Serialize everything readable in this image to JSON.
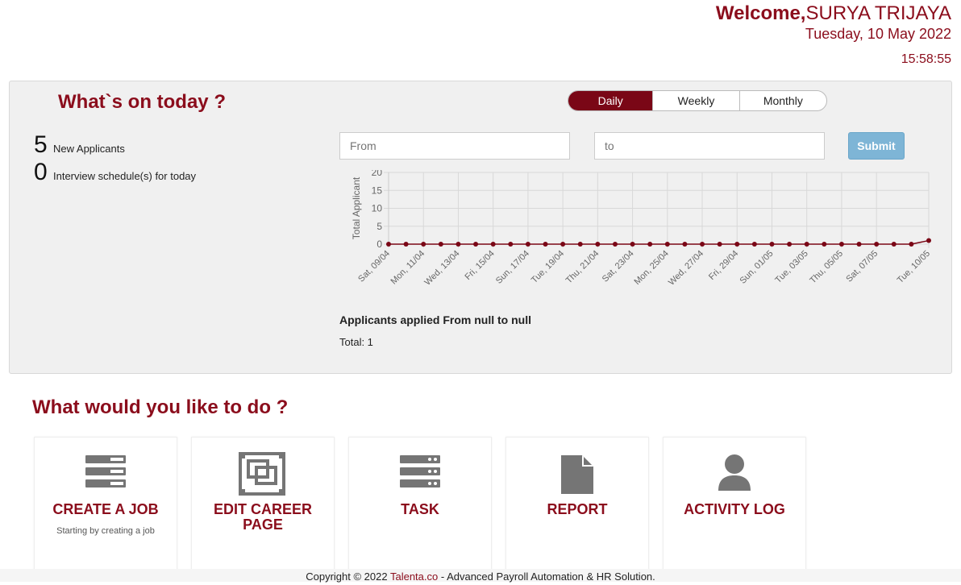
{
  "header": {
    "welcome_prefix": "Welcome,",
    "user_name": "SURYA TRIJAYA",
    "date": "Tuesday, 10 May 2022",
    "time": "15:58:55"
  },
  "today": {
    "title": "What`s on today ?",
    "tabs": [
      "Daily",
      "Weekly",
      "Monthly"
    ],
    "active_tab": "Daily",
    "stats": [
      {
        "value": "5",
        "label": "New Applicants"
      },
      {
        "value": "0",
        "label": "Interview schedule(s) for today"
      }
    ],
    "from_placeholder": "From",
    "to_placeholder": "to",
    "submit_label": "Submit",
    "applied_text": "Applicants applied From null to null",
    "total_text": "Total: 1"
  },
  "chart_data": {
    "type": "line",
    "ylabel": "Total Applicant",
    "ylim": [
      0,
      20
    ],
    "yticks": [
      0,
      5,
      10,
      15,
      20
    ],
    "x": [
      "Sat, 09/04",
      "Sun, 10/04",
      "Mon, 11/04",
      "Tue, 12/04",
      "Wed, 13/04",
      "Thu, 14/04",
      "Fri, 15/04",
      "Sat, 16/04",
      "Sun, 17/04",
      "Mon, 18/04",
      "Tue, 19/04",
      "Wed, 20/04",
      "Thu, 21/04",
      "Fri, 22/04",
      "Sat, 23/04",
      "Sun, 24/04",
      "Mon, 25/04",
      "Tue, 26/04",
      "Wed, 27/04",
      "Thu, 28/04",
      "Fri, 29/04",
      "Sat, 30/04",
      "Sun, 01/05",
      "Mon, 02/05",
      "Tue, 03/05",
      "Wed, 04/05",
      "Thu, 05/05",
      "Fri, 06/05",
      "Sat, 07/05",
      "Sun, 08/05",
      "Mon, 09/05",
      "Tue, 10/05"
    ],
    "tick_labels": [
      "Sat, 09/04",
      "Mon, 11/04",
      "Wed, 13/04",
      "Fri, 15/04",
      "Sun, 17/04",
      "Tue, 19/04",
      "Thu, 21/04",
      "Sat, 23/04",
      "Mon, 25/04",
      "Wed, 27/04",
      "Fri, 29/04",
      "Sun, 01/05",
      "Tue, 03/05",
      "Thu, 05/05",
      "Sat, 07/05",
      "Tue, 10/05"
    ],
    "series": [
      {
        "values": [
          0,
          0,
          0,
          0,
          0,
          0,
          0,
          0,
          0,
          0,
          0,
          0,
          0,
          0,
          0,
          0,
          0,
          0,
          0,
          0,
          0,
          0,
          0,
          0,
          0,
          0,
          0,
          0,
          0,
          0,
          0,
          1
        ],
        "color": "#7a0716"
      }
    ],
    "grid": true
  },
  "actions": {
    "title": "What would you like to do ?",
    "cards": [
      {
        "title": "CREATE A JOB",
        "subtitle": "Starting by creating a job",
        "icon": "server-list-icon"
      },
      {
        "title": "EDIT CAREER PAGE",
        "subtitle": "",
        "icon": "layers-frame-icon"
      },
      {
        "title": "TASK",
        "subtitle": "",
        "icon": "server-list-icon"
      },
      {
        "title": "REPORT",
        "subtitle": "",
        "icon": "document-icon"
      },
      {
        "title": "ACTIVITY LOG",
        "subtitle": "",
        "icon": "user-icon"
      }
    ]
  },
  "footer": {
    "prefix": "Copyright © 2022 ",
    "brand": "Talenta.co",
    "suffix": " - Advanced Payroll Automation & HR Solution."
  },
  "colors": {
    "brand": "#8b0d1c",
    "active_tab": "#7a0716",
    "submit": "#7eb5d6",
    "icon": "#757575"
  }
}
